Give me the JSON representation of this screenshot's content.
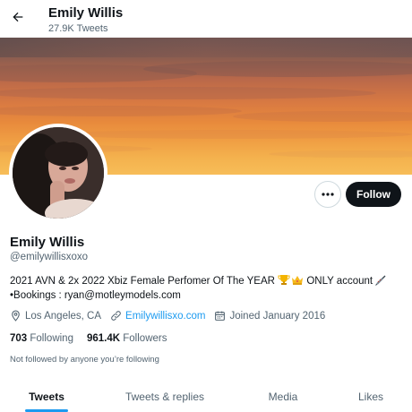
{
  "header": {
    "name": "Emily Willis",
    "tweet_count": "27.9K Tweets",
    "back_icon": "arrow-left-icon"
  },
  "profile": {
    "display_name": "Emily Willis",
    "handle": "@emilywillisxoxo",
    "bio_line1_a": "2021 AVN & 2x 2022 Xbiz Female Perfomer Of The YEAR ",
    "bio_line1_b": " ONLY account",
    "bio_line2": "•Bookings : ryan@motleymodels.com",
    "bio_emojis": [
      "trophy-icon",
      "crown-icon",
      "syringe-icon"
    ],
    "location": "Los Angeles, CA",
    "website": "Emilywillisxo.com",
    "joined": "Joined January 2016",
    "following_count": "703",
    "following_label": "Following",
    "followers_count": "961.4K",
    "followers_label": "Followers",
    "not_followed_text": "Not followed by anyone you’re following"
  },
  "actions": {
    "more_icon": "more-horizontal-icon",
    "follow_label": "Follow"
  },
  "tabs": [
    {
      "label": "Tweets",
      "active": true
    },
    {
      "label": "Tweets & replies",
      "active": false
    },
    {
      "label": "Media",
      "active": false
    },
    {
      "label": "Likes",
      "active": false
    }
  ],
  "colors": {
    "accent": "#1d9bf0",
    "text_primary": "#0f1419",
    "text_secondary": "#536471",
    "follow_button": "#0f1419"
  }
}
